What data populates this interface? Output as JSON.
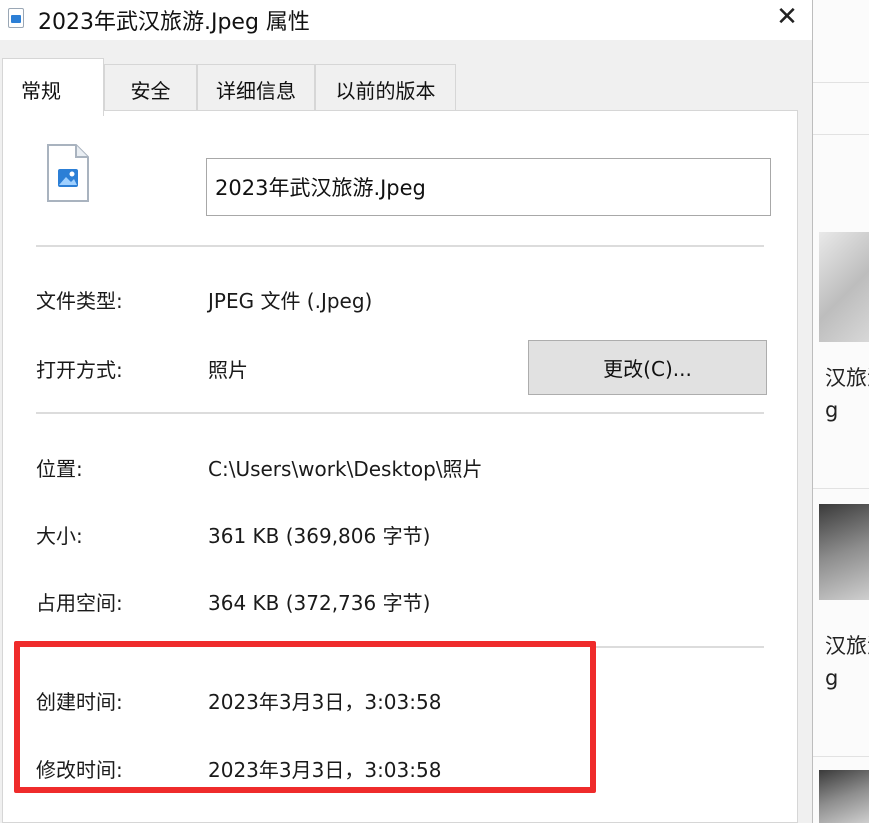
{
  "window": {
    "title": "2023年武汉旅游.Jpeg 属性",
    "close_glyph": "✕"
  },
  "tabs": [
    {
      "label": "常规",
      "active": true
    },
    {
      "label": "安全",
      "active": false
    },
    {
      "label": "详细信息",
      "active": false
    },
    {
      "label": "以前的版本",
      "active": false
    }
  ],
  "general": {
    "file_name": "2023年武汉旅游.Jpeg",
    "file_type_label": "文件类型:",
    "file_type_value": "JPEG 文件 (.Jpeg)",
    "open_with_label": "打开方式:",
    "open_with_value": "照片",
    "change_button": "更改(C)...",
    "location_label": "位置:",
    "location_value": "C:\\Users\\work\\Desktop\\照片",
    "size_label": "大小:",
    "size_value": "361 KB (369,806 字节)",
    "size_on_disk_label": "占用空间:",
    "size_on_disk_value": "364 KB (372,736 字节)",
    "created_label": "创建时间:",
    "created_value": "2023年3月3日，3:03:58",
    "modified_label": "修改时间:",
    "modified_value": "2023年3月3日，3:03:58"
  },
  "background_window": {
    "item_1_line_1": "汉旅游",
    "item_1_line_2": "g",
    "item_2_line_1": "汉旅游",
    "item_2_line_2": "g"
  },
  "colors": {
    "highlight": "#ef2b2b",
    "dialog_bg": "#f0f0f0",
    "panel_bg": "#ffffff",
    "button_bg": "#e1e1e1"
  },
  "icons": {
    "file": "image-file-icon",
    "close": "close-icon"
  }
}
